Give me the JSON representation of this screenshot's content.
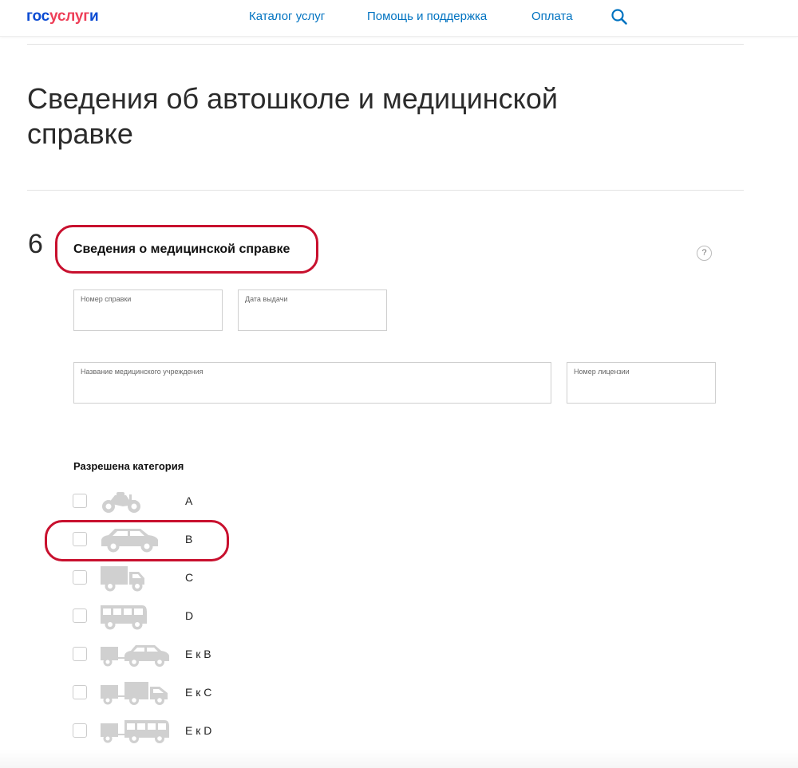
{
  "header": {
    "logo": {
      "part1": "гос",
      "part2": "услуг",
      "part3": "и"
    },
    "nav": [
      "Каталог услуг",
      "Помощь и поддержка",
      "Оплата"
    ],
    "search_icon": "search-icon"
  },
  "page": {
    "title": "Сведения об автошколе и медицинской справке"
  },
  "section": {
    "number": "6",
    "title": "Сведения о медицинской справке",
    "help": "?",
    "fields": {
      "certificate_number": "Номер справки",
      "issue_date": "Дата выдачи",
      "institution_name": "Название медицинского учреждения",
      "license_number": "Номер лицензии"
    }
  },
  "categories": {
    "heading": "Разрешена категория",
    "items": [
      {
        "label": "A",
        "icon": "motorcycle-icon"
      },
      {
        "label": "B",
        "icon": "car-icon"
      },
      {
        "label": "C",
        "icon": "truck-icon"
      },
      {
        "label": "D",
        "icon": "bus-icon"
      },
      {
        "label": "E к B",
        "icon": "car-trailer-icon"
      },
      {
        "label": "E к C",
        "icon": "truck-trailer-icon"
      },
      {
        "label": "E к D",
        "icon": "bus-trailer-icon"
      }
    ]
  },
  "colors": {
    "link": "#0173c1",
    "logo_blue": "#0d4cd3",
    "logo_red": "#ee3f58",
    "highlight": "#c8102e",
    "icon_gray": "#d0d0d0"
  }
}
